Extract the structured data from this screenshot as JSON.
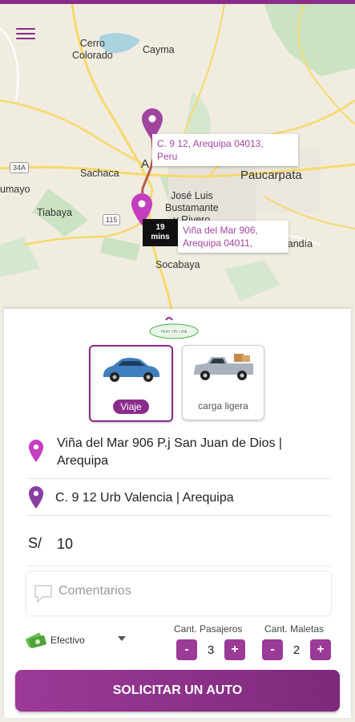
{
  "map": {
    "places": {
      "cerro_colorado": "Cerro\nColorado",
      "cayma": "Cayma",
      "sachaca": "Sachaca",
      "umayo": "umayo",
      "tiabaya": "Tiabaya",
      "paucarpata": "Paucarpata",
      "jose_luis": "José Luis\nBustamante\ny Rivero",
      "socabaya": "Socabaya",
      "landia": "landía",
      "arequipa_partial": "A"
    },
    "road_labels": {
      "r34a": "34A",
      "r115": "115"
    },
    "destination_callout": "C. 9 12, Arequipa 04013,\nPeru",
    "origin_callout": "Viña del Mar 906,\nArequipa 04011,",
    "eta": {
      "value": "19",
      "unit": "mins"
    },
    "colors": {
      "pin": "#a0459e",
      "route": "#b55a4a",
      "water": "#aad3df",
      "park": "#c9e3c3"
    }
  },
  "logo_text": "TRAY ON LINE",
  "vehicles": [
    {
      "label": "Viaje",
      "selected": true,
      "icon": "sedan-car-icon"
    },
    {
      "label": "carga ligera",
      "selected": false,
      "icon": "pickup-truck-icon"
    }
  ],
  "origin": {
    "text": "Viña del Mar 906 P.j San Juan de Dios |\nArequipa",
    "icon": "map-pin-icon"
  },
  "destination": {
    "text": "C. 9 12 Urb Valencia | Arequipa",
    "icon": "map-pin-icon"
  },
  "fare": {
    "currency": "S/",
    "value": "10"
  },
  "comment": {
    "placeholder": "Comentarios",
    "icon": "speech-bubble-icon"
  },
  "payment": {
    "label": "Efectivo",
    "icon": "cash-icon"
  },
  "passengers": {
    "label": "Cant. Pasajeros",
    "value": "3",
    "minus": "-",
    "plus": "+"
  },
  "luggage": {
    "label": "Cant. Maletas",
    "value": "2",
    "minus": "-",
    "plus": "+"
  },
  "cta_label": "SOLICITAR UN AUTO",
  "accent_color": "#8a2c8a"
}
